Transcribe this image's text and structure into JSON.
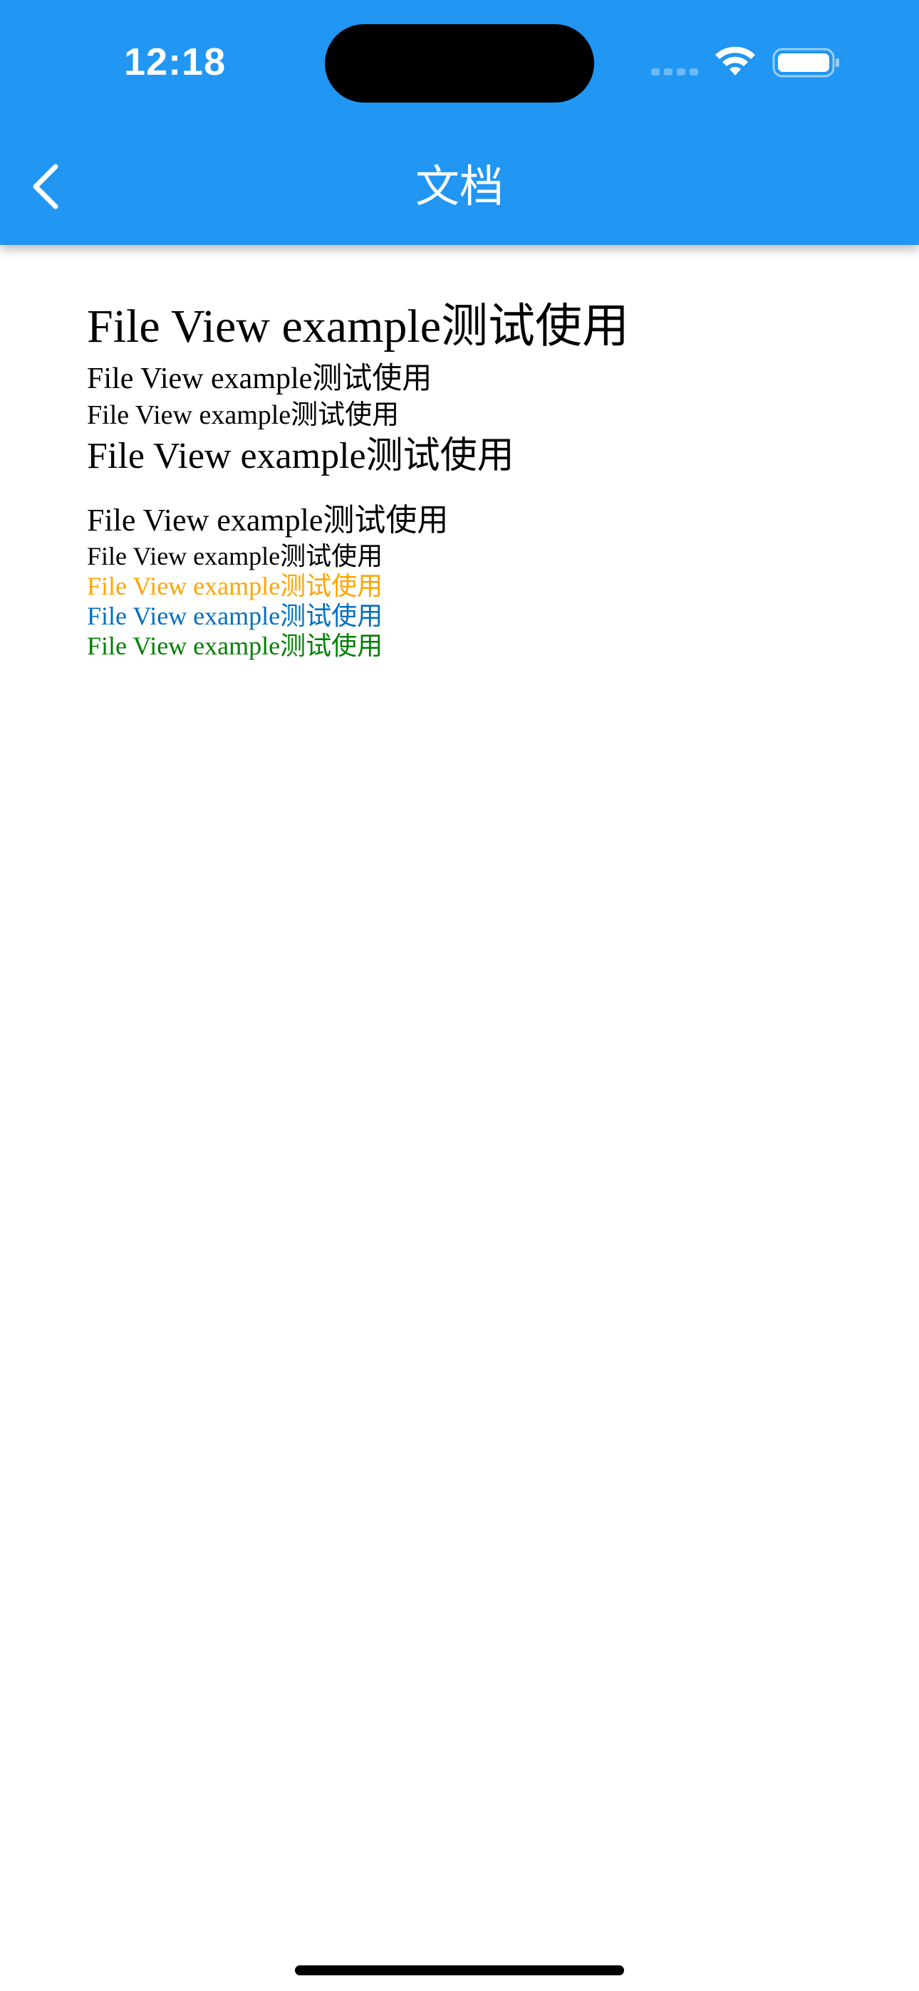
{
  "status_bar": {
    "time": "12:18",
    "icons": [
      "signal-icon",
      "wifi-icon",
      "battery-icon"
    ]
  },
  "app_bar": {
    "title": "文档",
    "back_icon": "chevron-left-icon",
    "background_color": "#2196F3",
    "foreground_color": "#FFFFFF"
  },
  "document": {
    "lines": [
      {
        "text": "File View example测试使用",
        "color": "#000000"
      },
      {
        "text": "File View example测试使用",
        "color": "#000000"
      },
      {
        "text": "File View example测试使用",
        "color": "#000000"
      },
      {
        "text": "File View example测试使用",
        "color": "#000000"
      },
      {
        "text": "File View example测试使用",
        "color": "#000000"
      },
      {
        "text": "File View example测试使用",
        "color": "#000000"
      },
      {
        "text": "File View example测试使用",
        "color": "#FFA500"
      },
      {
        "text": "File View example测试使用",
        "color": "#0070C0"
      },
      {
        "text": "File View example测试使用",
        "color": "#008000"
      }
    ]
  }
}
